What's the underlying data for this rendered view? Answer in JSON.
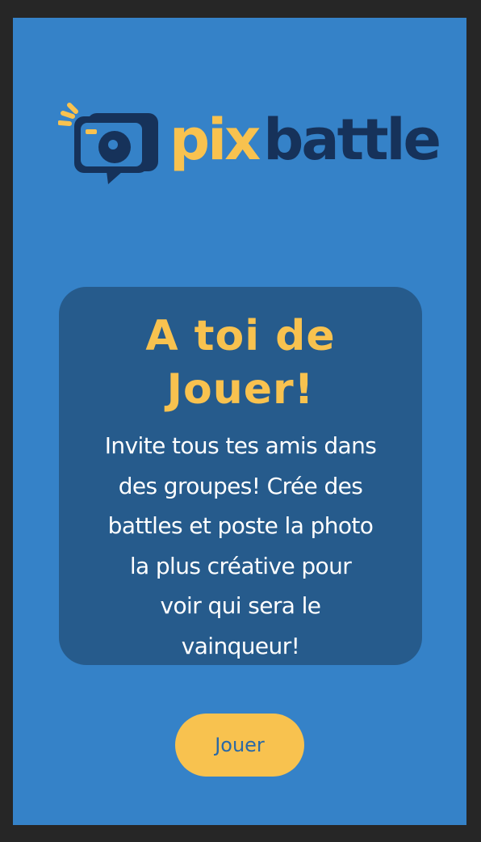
{
  "app": {
    "logo": {
      "brand_pix": "pix",
      "brand_battle": "battle",
      "icon": "camera-speech-bubble-icon"
    }
  },
  "card": {
    "title_line1": "A toi de",
    "title_line2": "Jouer!",
    "body_lines": [
      "Invite tous tes amis dans",
      "des groupes! Crée des",
      "battles et poste la photo",
      "la plus créative pour",
      "voir qui sera le",
      "vainqueur!"
    ]
  },
  "actions": {
    "play_label": "Jouer"
  },
  "colors": {
    "frame": "#262626",
    "background": "#3582c8",
    "card": "#265b8c",
    "accent_yellow": "#f8c24f",
    "dark_navy": "#16325a",
    "button_text": "#2a69a6"
  }
}
